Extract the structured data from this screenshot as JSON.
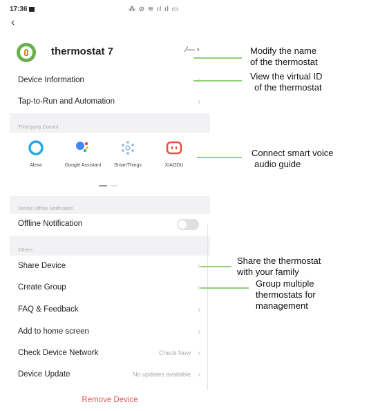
{
  "status_bar": {
    "time": "17:36",
    "icons_text": "⁂ ⊘ ≋ ıl ıl ▭"
  },
  "device": {
    "name": "thermostat 7"
  },
  "menu": {
    "device_information": "Device Information",
    "tap_to_run": "Tap-to-Run and Automation",
    "third_party_section": "Third-party Control",
    "offline_section": "Device Offline Notification",
    "offline_notification": "Offline Notification",
    "others_section": "Others",
    "share_device": "Share Device",
    "create_group": "Create Group",
    "faq": "FAQ & Feedback",
    "add_home": "Add to home screen",
    "check_network": "Check Device Network",
    "check_now": "Check Now",
    "device_update": "Device Update",
    "no_updates": "No updates available",
    "remove_device": "Remove Device"
  },
  "third_party": [
    {
      "name": "Alexa",
      "icon": "alexa-icon"
    },
    {
      "name": "Google Assistant",
      "icon": "google-assistant-icon"
    },
    {
      "name": "SmartThings",
      "icon": "smartthings-icon"
    },
    {
      "name": "XIAODU",
      "icon": "xiaodu-icon"
    }
  ],
  "toggles": {
    "offline_notification": false
  },
  "annotations": {
    "modify_name_1": "Modify the name",
    "modify_name_2": "of the thermostat",
    "virtual_id_1": "View the virtual ID",
    "virtual_id_2": "of the thermostat",
    "voice_1": "Connect smart voice",
    "voice_2": "audio guide",
    "share_1": "Share the thermostat",
    "share_2": "with your family",
    "group_1": "Group multiple",
    "group_2": "thermostats for",
    "group_3": "management"
  },
  "colors": {
    "accent": "#6ab04c",
    "danger": "#e05a5a",
    "callout_line": "#8fcf76",
    "section_bg": "#f2f2f4"
  }
}
